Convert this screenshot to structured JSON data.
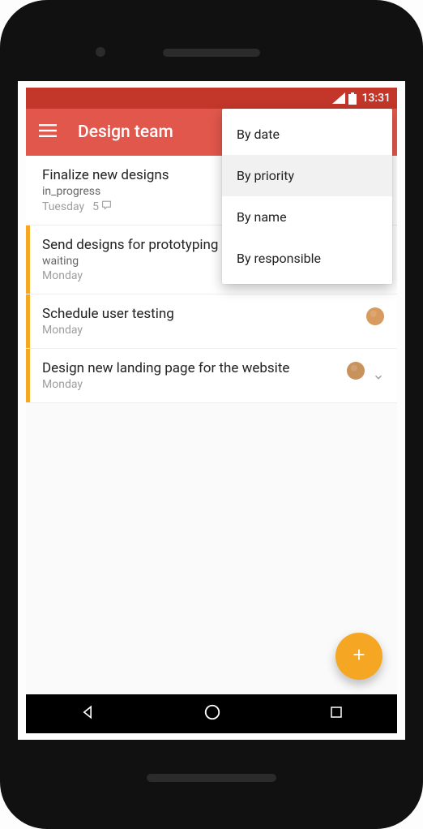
{
  "status": {
    "time": "13:31"
  },
  "appbar": {
    "title": "Design team"
  },
  "menu": {
    "items": [
      {
        "label": "By date",
        "selected": false
      },
      {
        "label": "By priority",
        "selected": true
      },
      {
        "label": "By name",
        "selected": false
      },
      {
        "label": "By responsible",
        "selected": false
      }
    ]
  },
  "tasks": [
    {
      "title": "Finalize new designs",
      "status": "in_progress",
      "date": "Tuesday",
      "comments_count": "5",
      "accent": null,
      "avatar": null,
      "expandable": false
    },
    {
      "title": "Send designs for prototyping",
      "status": "waiting",
      "date": "Monday",
      "comments_count": null,
      "accent": "#f5a623",
      "avatar": null,
      "expandable": false
    },
    {
      "title": "Schedule user testing",
      "status": null,
      "date": "Monday",
      "comments_count": null,
      "accent": "#f5a623",
      "avatar": "#d89a5e",
      "expandable": false
    },
    {
      "title": "Design new landing page for the website",
      "status": null,
      "date": "Monday",
      "comments_count": null,
      "accent": "#f5a623",
      "avatar": "#c7925b",
      "expandable": true
    }
  ]
}
